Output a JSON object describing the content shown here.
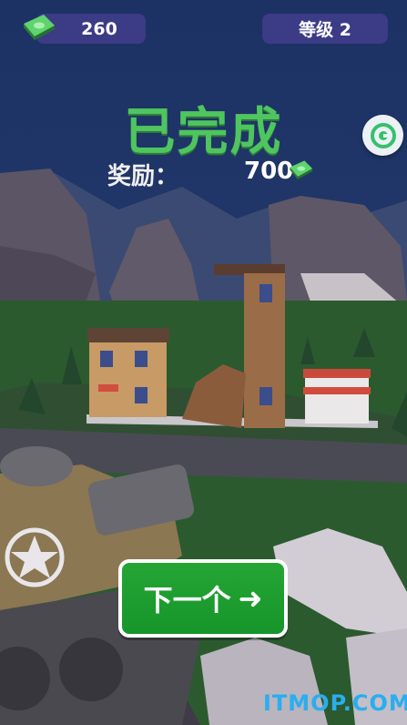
{
  "hud": {
    "cash_value": "260",
    "level_label": "等级 2"
  },
  "result": {
    "title": "已完成",
    "reward_label": "奖励：",
    "reward_value": "700"
  },
  "buttons": {
    "next_label": "下一个",
    "next_arrow": "➜"
  },
  "icons": {
    "cash": "cash-stack-icon",
    "side": "game-center-icon"
  },
  "watermark": "ITMOP.COM",
  "colors": {
    "title_green": "#4fc55f",
    "pill_purple": "#3c3b86",
    "button_green": "#1a9c2e",
    "watermark_blue": "#29aef0"
  }
}
